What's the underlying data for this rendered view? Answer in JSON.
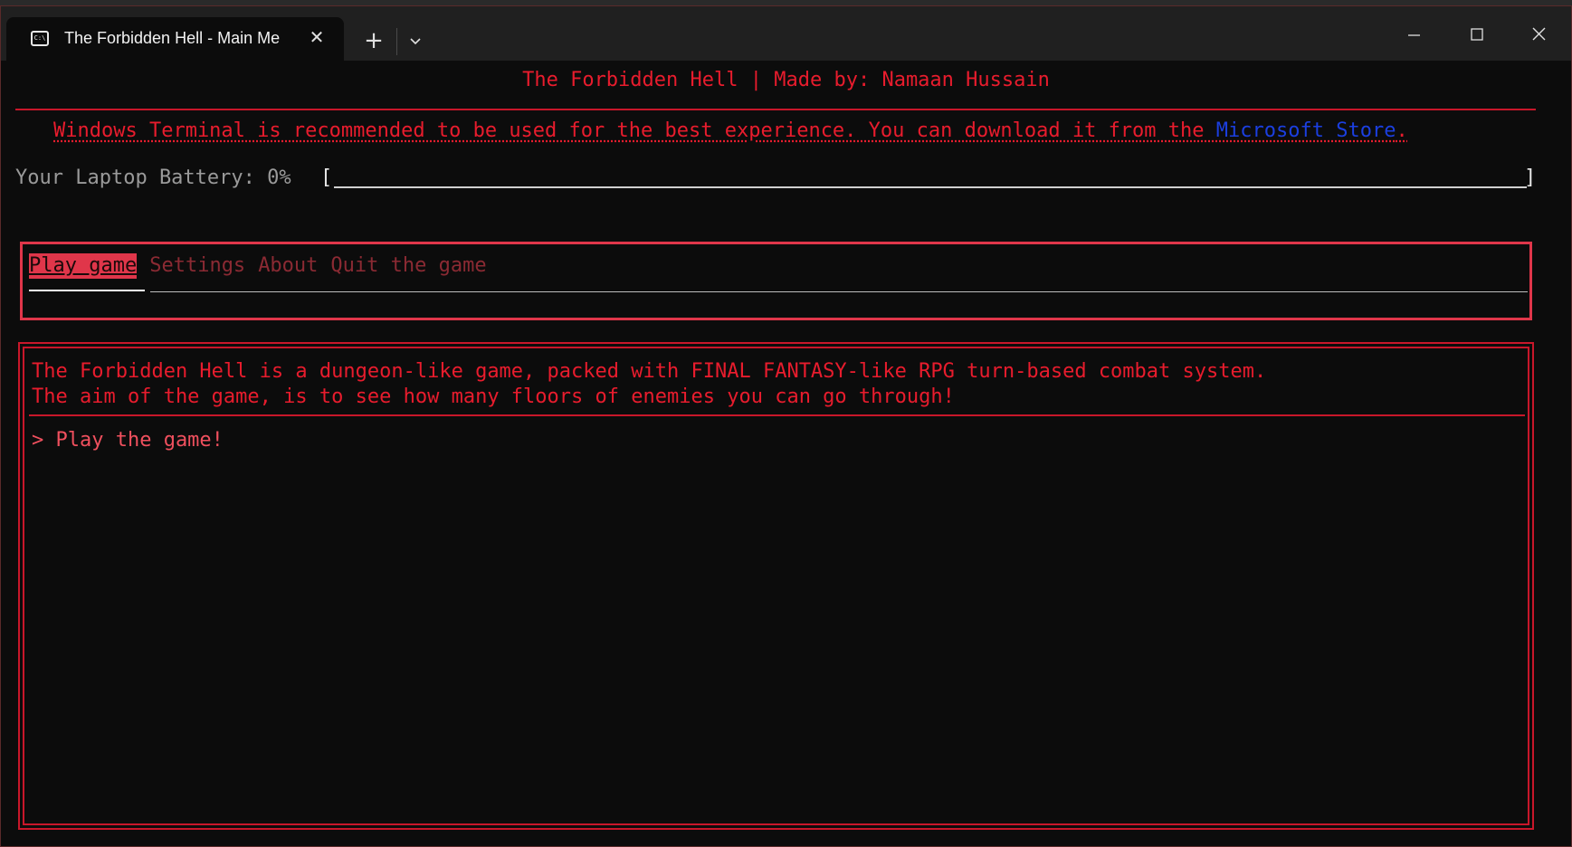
{
  "window": {
    "tab_title": "The Forbidden Hell - Main Me",
    "tab_icon": "terminal-icon",
    "tab_icon_glyph": "C:\\",
    "close_tab_glyph": "✕",
    "new_tab_glyph": "+",
    "controls": [
      "minimize-icon",
      "maximize-icon",
      "close-icon"
    ]
  },
  "terminal": {
    "header": "The Forbidden Hell | Made by: Namaan Hussain",
    "recommend_text": "Windows Terminal is recommended to be used for the best experience. You can download it from the ",
    "recommend_link": "Microsoft Store",
    "recommend_end": ".",
    "battery_label": "Your Laptop Battery: 0%",
    "battery_open": "[",
    "battery_close": "]",
    "battery_percent": 0,
    "menu": {
      "items": [
        "Play game",
        "Settings",
        "About",
        "Quit the game"
      ],
      "selected_index": 0
    },
    "description_line1": "The Forbidden Hell is a dungeon-like game, packed with FINAL FANTASY-like RPG turn-based combat system.",
    "description_line2": "The aim of the game, is to see how many floors of enemies you can go through!",
    "play_option": "> Play the game!"
  },
  "colors": {
    "accent_red": "#e81c2d",
    "menu_highlight": "#e0364a",
    "link_blue": "#1b3fe0",
    "background": "#0c0c0c"
  }
}
